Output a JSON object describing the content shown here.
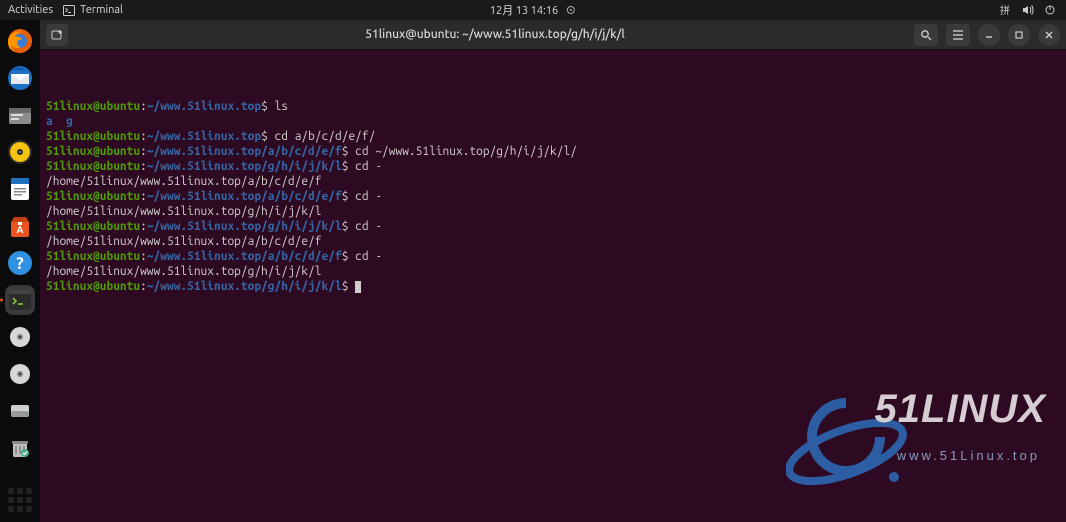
{
  "topbar": {
    "activities": "Activities",
    "app_name": "Terminal",
    "clock": "12月 13  14:16"
  },
  "dock": {
    "items": [
      {
        "name": "firefox-icon"
      },
      {
        "name": "thunderbird-icon"
      },
      {
        "name": "files-icon"
      },
      {
        "name": "rhythmbox-icon"
      },
      {
        "name": "writer-icon"
      },
      {
        "name": "software-icon"
      },
      {
        "name": "help-icon"
      },
      {
        "name": "terminal-icon"
      },
      {
        "name": "disc1-icon"
      },
      {
        "name": "disc2-icon"
      },
      {
        "name": "drive-icon"
      },
      {
        "name": "trash-icon"
      }
    ]
  },
  "window": {
    "title": "51linux@ubuntu: ~/www.51linux.top/g/h/i/j/k/l"
  },
  "terminal": {
    "user": "51linux",
    "host": "ubuntu",
    "at": "@",
    "colon": ":",
    "dollar": "$",
    "lines": [
      {
        "path": "~/www.51linux.top",
        "cmd": " ls"
      },
      {
        "out_dirs": "a  g"
      },
      {
        "path": "~/www.51linux.top",
        "cmd": " cd a/b/c/d/e/f/"
      },
      {
        "path": "~/www.51linux.top/a/b/c/d/e/f",
        "cmd": " cd ~/www.51linux.top/g/h/i/j/k/l/"
      },
      {
        "path": "~/www.51linux.top/g/h/i/j/k/l",
        "cmd": " cd -"
      },
      {
        "out": "/home/51linux/www.51linux.top/a/b/c/d/e/f"
      },
      {
        "path": "~/www.51linux.top/a/b/c/d/e/f",
        "cmd": " cd -"
      },
      {
        "out": "/home/51linux/www.51linux.top/g/h/i/j/k/l"
      },
      {
        "path": "~/www.51linux.top/g/h/i/j/k/l",
        "cmd": " cd -"
      },
      {
        "out": "/home/51linux/www.51linux.top/a/b/c/d/e/f"
      },
      {
        "path": "~/www.51linux.top/a/b/c/d/e/f",
        "cmd": " cd -"
      },
      {
        "out": "/home/51linux/www.51linux.top/g/h/i/j/k/l"
      },
      {
        "path": "~/www.51linux.top/g/h/i/j/k/l",
        "cmd": " ",
        "cursor": true
      }
    ]
  },
  "watermark": {
    "big": "51LINUX",
    "small": "www.51Linux.top"
  }
}
